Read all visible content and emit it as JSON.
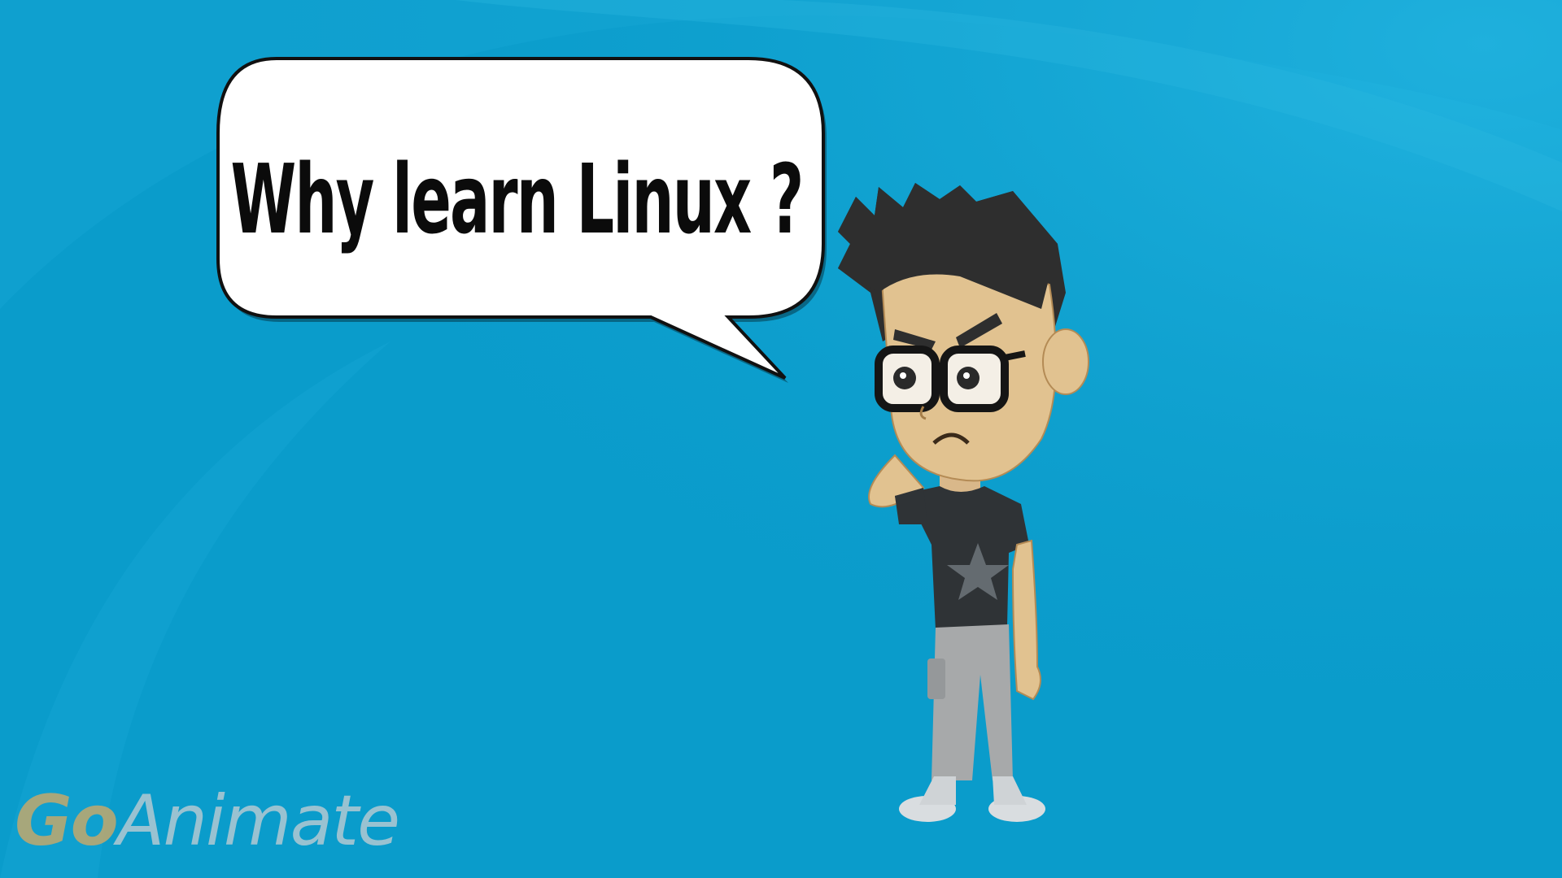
{
  "scene": {
    "background_color": "#0a9ccb",
    "speech_bubble": {
      "text": "Why learn Linux ?"
    },
    "character": {
      "description_icon": "thinking-boy-icon"
    }
  },
  "watermark": {
    "part1": "Go",
    "part2": "Animate"
  }
}
